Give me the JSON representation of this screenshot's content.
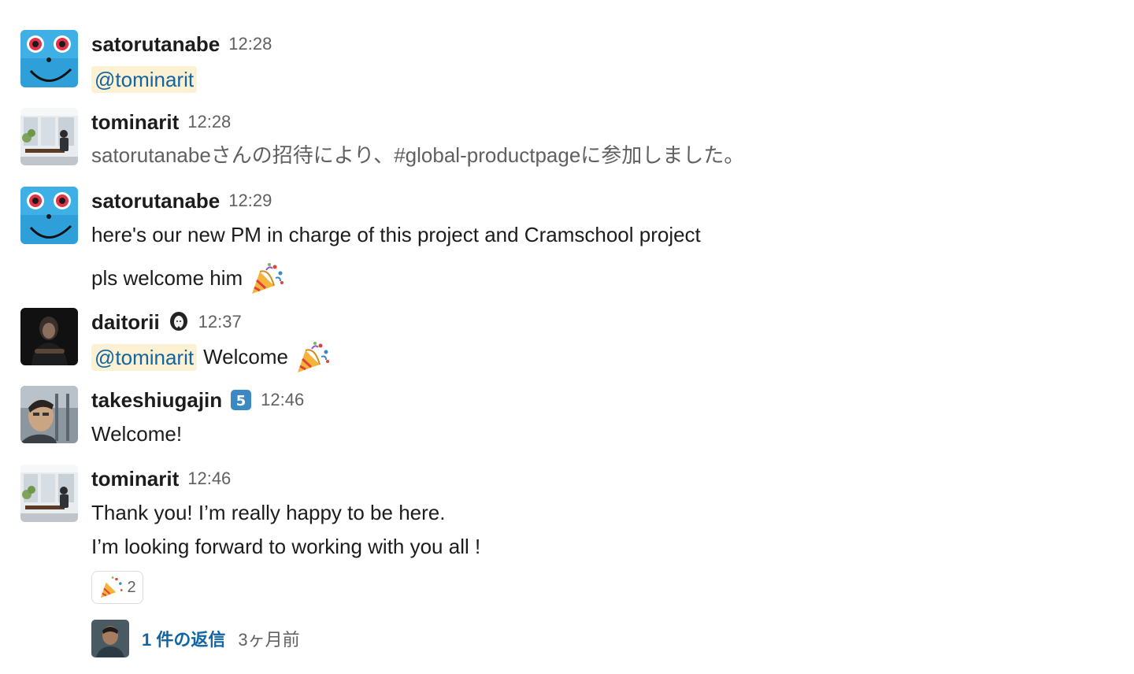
{
  "messages": [
    {
      "author": "satorutanabe",
      "time": "12:28",
      "avatar": "blue-monster-avatar",
      "lines": [
        {
          "mention": "@tominarit"
        }
      ]
    },
    {
      "author": "tominarit",
      "time": "12:28",
      "avatar": "office-photo-avatar",
      "lines": [
        {
          "text": "satorutanabeさんの招待により、#global-productpageに参加しました。"
        }
      ]
    },
    {
      "author": "satorutanabe",
      "time": "12:29",
      "avatar": "blue-monster-avatar",
      "lines": [
        {
          "text": "here's our new PM in charge of this project and Cramschool project"
        },
        {
          "text": "pls welcome him",
          "emoji": "party-popper-icon"
        }
      ]
    },
    {
      "author": "daitorii",
      "time": "12:37",
      "status_emoji": "long-hair-face-icon",
      "avatar": "dark-portrait-avatar",
      "lines": [
        {
          "mention": "@tominarit",
          "text": "Welcome",
          "emoji": "party-popper-icon"
        }
      ]
    },
    {
      "author": "takeshiugajin",
      "time": "12:46",
      "status_emoji": "keycap-5-icon",
      "avatar": "selfie-avatar",
      "lines": [
        {
          "text": "Welcome!"
        }
      ]
    },
    {
      "author": "tominarit",
      "time": "12:46",
      "avatar": "office-photo-avatar",
      "lines": [
        {
          "text": "Thank you! I’m really happy to be here."
        },
        {
          "text": "I’m looking forward to working with you all !"
        }
      ],
      "reaction": {
        "emoji": "party-popper-icon",
        "count": "2"
      },
      "thread": {
        "replies_label": "1 件の返信",
        "time_ago": "3ヶ月前",
        "avatar": "reply-user-avatar"
      }
    }
  ],
  "colors": {
    "mention_bg": "#fcf1d2",
    "mention_text": "#1264a3",
    "link": "#1264a3",
    "muted": "#616061",
    "text": "#1d1c1d",
    "keycap_bg": "#3b88c3"
  }
}
